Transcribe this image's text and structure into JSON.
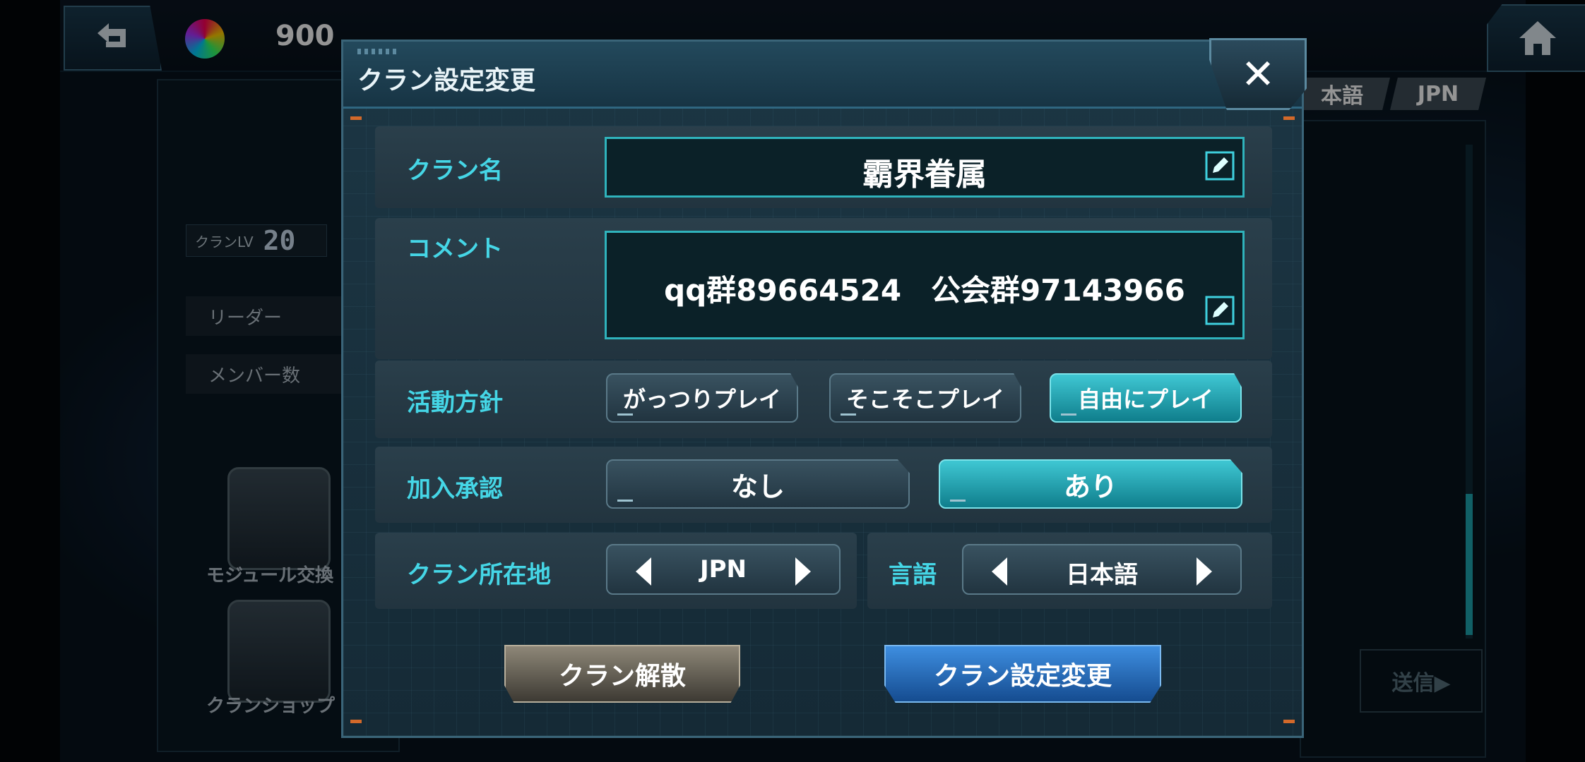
{
  "top_bar": {
    "back_icon": "back-arrow-icon",
    "home_icon": "home-icon",
    "gems": "900"
  },
  "background": {
    "clan_lv_label": "クランLV",
    "clan_lv_value": "20",
    "leader_label": "リーダー",
    "member_count_label": "メンバー数",
    "module_exchange_label": "モジュール交換",
    "clan_shop_label": "クランショップ",
    "lang_tab_1": "本語",
    "lang_tab_2": "JPN",
    "send_label": "送信▶"
  },
  "dialog": {
    "title": "クラン設定変更",
    "close_label": "✕",
    "clan_name": {
      "label": "クラン名",
      "value": "霸界眷属"
    },
    "comment": {
      "label": "コメント",
      "value": "qq群89664524　公会群97143966"
    },
    "activity_policy": {
      "label": "活動方針",
      "options": [
        "がっつりプレイ",
        "そこそこプレイ",
        "自由にプレイ"
      ],
      "selected_index": 2
    },
    "join_approval": {
      "label": "加入承認",
      "options": [
        "なし",
        "あり"
      ],
      "selected_index": 1
    },
    "location": {
      "label": "クラン所在地",
      "value": "JPN"
    },
    "language": {
      "label": "言語",
      "value": "日本語"
    },
    "disband_button": "クラン解散",
    "change_button": "クラン設定変更"
  },
  "colors": {
    "label_cyan": "#45d6e6",
    "active_option": "#2fb3bc",
    "change_button_blue": "#2a6fbf",
    "disband_button_brown": "#6b655a"
  }
}
